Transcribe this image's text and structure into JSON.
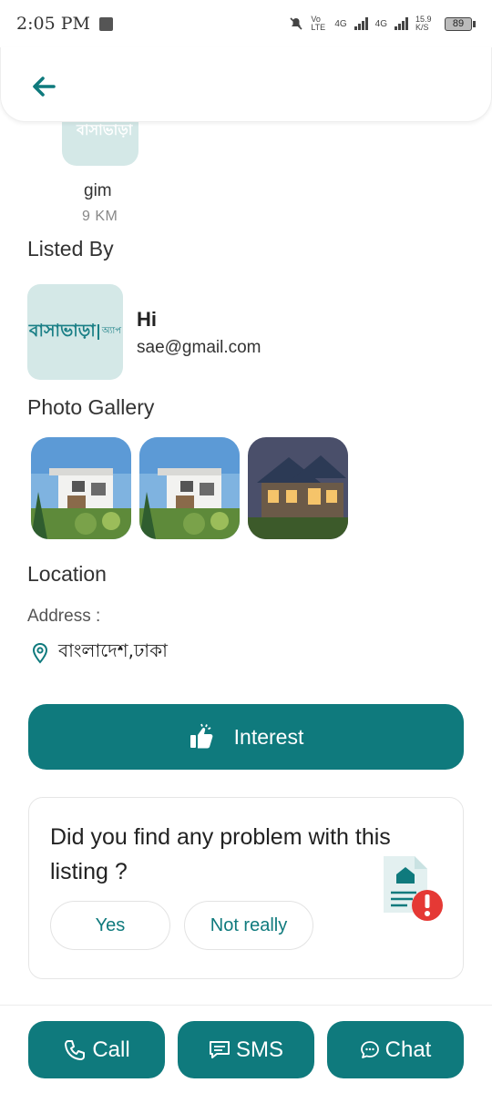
{
  "status_bar": {
    "time": "2:05 PM",
    "network_1": "Vo LTE",
    "network_2": "4G",
    "network_3": "4G",
    "speed": "15.9 K/S",
    "battery": "89"
  },
  "header": {
    "back_icon": "arrow-left-icon"
  },
  "listing_preview": {
    "name": "gim",
    "distance": "9 KM"
  },
  "listed_by": {
    "title": "Listed By",
    "logo_text": "বাসাভাড়া",
    "logo_sub": "অ্যাপ",
    "name": "Hi",
    "email": "sae@gmail.com"
  },
  "gallery": {
    "title": "Photo Gallery",
    "photos": [
      "modern-house-photo",
      "modern-house-photo",
      "lit-house-photo"
    ]
  },
  "location": {
    "title": "Location",
    "address_label": "Address :",
    "address_value": "বাংলাদেশ,ঢাকা"
  },
  "interest_button": {
    "label": "Interest"
  },
  "problem": {
    "question": "Did you find any problem with this listing ?",
    "yes_label": "Yes",
    "no_label": "Not really"
  },
  "actions": {
    "call_label": "Call",
    "sms_label": "SMS",
    "chat_label": "Chat"
  },
  "colors": {
    "primary": "#0f7a7d",
    "thumb_bg": "#d4e8e7",
    "alert": "#e53935"
  }
}
